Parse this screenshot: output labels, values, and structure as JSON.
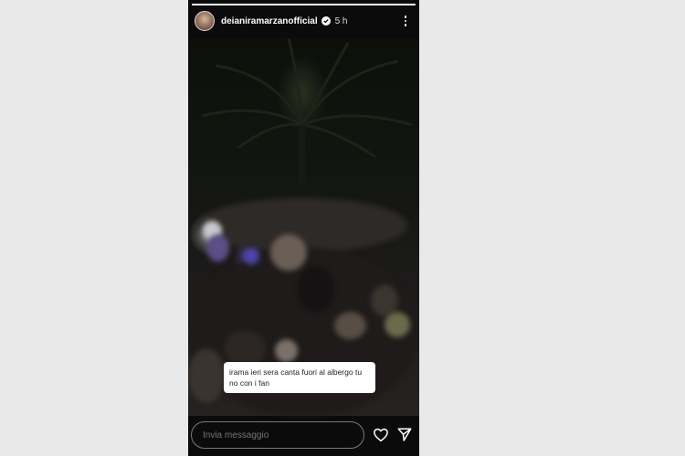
{
  "story": {
    "username": "deianiramarzanofficial",
    "time": "5 h",
    "progress": 1.0,
    "caption": "irama ieri sera canta fuori al albergo tu no con i fan",
    "verified": true
  },
  "reply": {
    "placeholder": "Invia messaggio"
  },
  "icons": {
    "menu": "more-vertical-icon",
    "like": "heart-icon",
    "send": "send-icon",
    "verified": "verified-badge-icon"
  },
  "colors": {
    "story_bg": "#0b0b0b",
    "page_bg": "#e9e9e9",
    "caption_bg": "#ffffff"
  }
}
